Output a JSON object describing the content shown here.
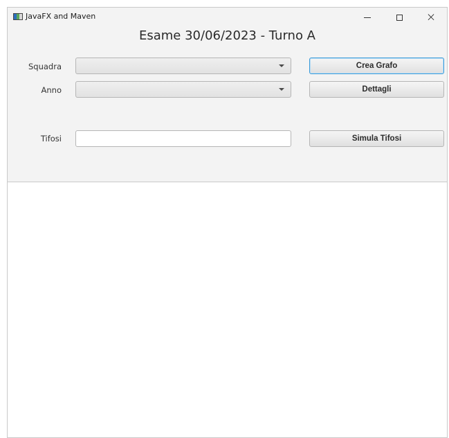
{
  "window": {
    "title": "JavaFX and Maven",
    "controls": {
      "minimize": "minimize",
      "maximize": "maximize",
      "close": "×"
    }
  },
  "header": {
    "title": "Esame 30/06/2023 - Turno A"
  },
  "form": {
    "squadra_label": "Squadra",
    "squadra_value": "",
    "anno_label": "Anno",
    "anno_value": "",
    "tifosi_label": "Tifosi",
    "tifosi_value": ""
  },
  "actions": {
    "crea_grafo": "Crea Grafo",
    "dettagli": "Dettagli",
    "simula_tifosi": "Simula Tifosi"
  },
  "output": {
    "text": ""
  },
  "colors": {
    "window_bg": "#f3f3f3",
    "focus_border": "#3a9ad8"
  }
}
